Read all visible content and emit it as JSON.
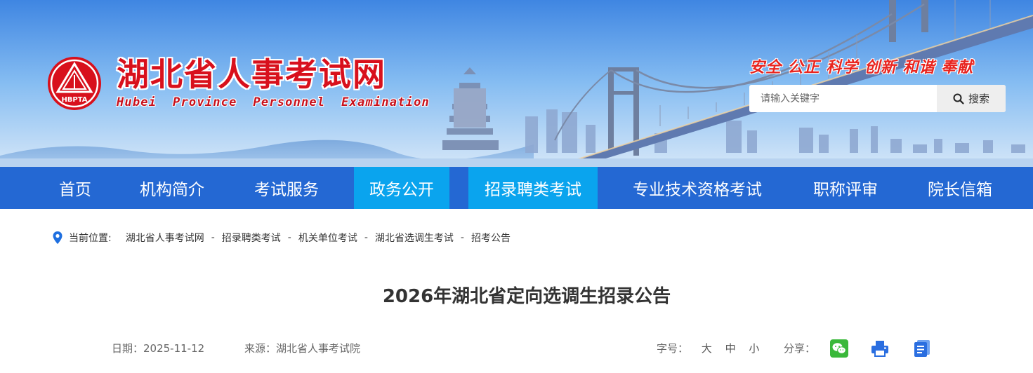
{
  "header": {
    "title": "湖北省人事考试网",
    "subtitle": "Hubei  Province  Personnel  Examination",
    "logo_text": "HBPTA",
    "slogan": "安全 公正 科学 创新 和谐 奉献",
    "search": {
      "placeholder": "请输入关键字",
      "button_label": "搜索"
    },
    "colors": {
      "brand_red": "#d8101c",
      "slogan_red": "#e8241f"
    }
  },
  "nav": {
    "items": [
      {
        "label": "首页"
      },
      {
        "label": "机构简介"
      },
      {
        "label": "考试服务"
      },
      {
        "label": "政务公开"
      },
      {
        "label": "招录聘类考试"
      },
      {
        "label": "专业技术资格考试"
      },
      {
        "label": "职称评审"
      },
      {
        "label": "院长信箱"
      }
    ],
    "colors": {
      "bar": "#2468d3",
      "highlight": "#0aa4ee"
    }
  },
  "breadcrumb": {
    "label": "当前位置:",
    "items": [
      "湖北省人事考试网",
      "招录聘类考试",
      "机关单位考试",
      "湖北省选调生考试",
      "招考公告"
    ],
    "separator": "-"
  },
  "article": {
    "title": "2026年湖北省定向选调生招录公告",
    "date": "日期：2025-11-12",
    "source": "来源：湖北省人事考试院",
    "font_size_label": "字号：",
    "font_sizes": [
      "大",
      "中",
      "小"
    ],
    "share_label": "分享：",
    "share_icons": [
      "wechat-icon",
      "print-icon",
      "document-icon"
    ]
  }
}
